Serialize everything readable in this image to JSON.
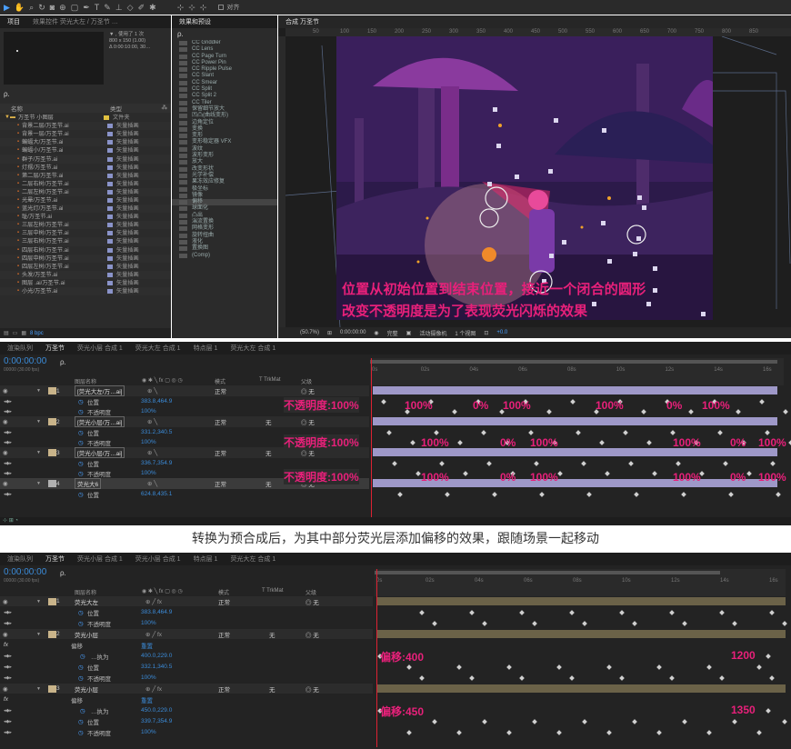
{
  "toolbar": {
    "label": "对齐"
  },
  "project": {
    "tab": "项目",
    "tab2": "效果控件 荧光大左 / 万圣节 …",
    "footage_info": [
      "▼ , 使用了 1 次",
      "800 x 150 (1.00)",
      "Δ 0:00:10:00, 30…"
    ],
    "search_placeholder": "ρ.",
    "col_name": "名称",
    "col_type": "类型",
    "items": [
      {
        "name": "万圣节 小图层",
        "type": "文件夹",
        "folder": true
      },
      {
        "name": "背景二层/万圣节.ai",
        "type": "矢量插画"
      },
      {
        "name": "背景一层/万圣节.ai",
        "type": "矢量插画"
      },
      {
        "name": "蝙蝠大/万圣节.ai",
        "type": "矢量插画"
      },
      {
        "name": "蝙蝠小/万圣节.ai",
        "type": "矢量插画"
      },
      {
        "name": "群子/万圣节.ai",
        "type": "矢量插画"
      },
      {
        "name": "灯摆/万圣节.ai",
        "type": "矢量插画"
      },
      {
        "name": "第二层/万圣节.ai",
        "type": "矢量插画"
      },
      {
        "name": "二层右树/万圣节.ai",
        "type": "矢量插画"
      },
      {
        "name": "二层左树/万圣节.ai",
        "type": "矢量插画"
      },
      {
        "name": "光晕/万圣节.ai",
        "type": "矢量插画"
      },
      {
        "name": "蓝光灯/万圣节.ai",
        "type": "矢量插画"
      },
      {
        "name": "耻/万圣节.ai",
        "type": "矢量插画"
      },
      {
        "name": "三层左树/万圣节.ai",
        "type": "矢量插画"
      },
      {
        "name": "三层中树/万圣节.ai",
        "type": "矢量插画"
      },
      {
        "name": "三层右树/万圣节.ai",
        "type": "矢量插画"
      },
      {
        "name": "四层右树/万圣节.ai",
        "type": "矢量插画"
      },
      {
        "name": "四层中树/万圣节.ai",
        "type": "矢量插画"
      },
      {
        "name": "四层左树/万圣节.ai",
        "type": "矢量插画"
      },
      {
        "name": "头发/万圣节.ai",
        "type": "矢量插画"
      },
      {
        "name": "图层 .ai/万圣节.ai",
        "type": "矢量插画"
      },
      {
        "name": "小光/万圣节.ai",
        "type": "矢量插画"
      }
    ],
    "bpc": "8 bpc"
  },
  "effects": {
    "tab": "效果和预设",
    "search": "ρ.",
    "items": [
      "CC Griddler",
      "CC Lens",
      "CC Page Turn",
      "CC Power Pin",
      "CC Ripple Pulse",
      "CC Slant",
      "CC Smear",
      "CC Split",
      "CC Split 2",
      "CC Tiler",
      "保留细节放大",
      "凹凸(曲线变形)",
      "边角定位",
      "变换",
      "变形",
      "变形稳定器 VFX",
      "波纹",
      "波形变形",
      "放大",
      "改变形状",
      "光学补偿",
      "果冻效应修复",
      "极坐标",
      "镜像",
      "偏移",
      "球面化",
      "凸出",
      "湍流置换",
      "网格变形",
      "旋转扭曲",
      "液化",
      "置换图",
      "(Comp)"
    ],
    "selected": "偏移"
  },
  "comp": {
    "tab": "合成",
    "tab_name": "万圣节",
    "rulers": [
      "50",
      "100",
      "150",
      "200",
      "250",
      "300",
      "350",
      "400",
      "450",
      "500",
      "550",
      "600",
      "650",
      "700",
      "750",
      "800",
      "850"
    ],
    "overlay_line1": "位置从初始位置到结束位置，接近一个闭合的圆形",
    "overlay_line2": "改变不透明度是为了表现荧光闪烁的效果",
    "footer": [
      "(50.7%)",
      "(完整)",
      "0:00:00:00",
      "完整",
      "活动摄像机",
      "1 个视图",
      "+0.0"
    ]
  },
  "tl1": {
    "tabs": [
      "渲染队列",
      "万圣节",
      "荧光小层 合成 1",
      "荧光大左 合成 1",
      "特点层 1",
      "荧光大左 合成 1"
    ],
    "time": "0:00:00:00",
    "time_sub": "00000 (30.00 fps)",
    "search": "ρ.",
    "head": {
      "name": "图层名称",
      "mode": "模式",
      "trk": "T TrkMat",
      "parent": "父级"
    },
    "layers": [
      {
        "num": "1",
        "name": "[荧光大左/万…ai]",
        "mode": "正常",
        "parent": "无",
        "pos": "383.8,464.9",
        "op": "100%"
      },
      {
        "num": "2",
        "name": "[荧光小层/万…ai]",
        "mode": "正常",
        "trk": "无",
        "parent": "无",
        "pos": "331.2,340.5",
        "op": "100%"
      },
      {
        "num": "3",
        "name": "[荧光小层/万…ai]",
        "mode": "正常",
        "trk": "无",
        "parent": "无",
        "pos": "336.7,354.9",
        "op": "100%"
      },
      {
        "num": "4",
        "name": "荧光大6",
        "mode": "正常",
        "trk": "无",
        "parent": "无",
        "pos": "624.8,435.1",
        "op": ""
      }
    ],
    "prop_pos": "位置",
    "prop_op": "不透明度",
    "ruler": [
      "0s",
      "02s",
      "04s",
      "06s",
      "08s",
      "10s",
      "12s",
      "14s",
      "16s"
    ],
    "ann": [
      {
        "label": "不透明度:100%",
        "vals": [
          "100%",
          "0%",
          "100%",
          "100%",
          "0%",
          "100%"
        ]
      },
      {
        "label": "不透明度:100%",
        "vals": [
          "100%",
          "0%",
          "100%",
          "100%",
          "0%",
          "100%"
        ]
      },
      {
        "label": "不透明度:100%",
        "vals": [
          "100%",
          "0%",
          "100%",
          "100%",
          "0%",
          "100%"
        ]
      }
    ]
  },
  "caption": "转换为预合成后，为其中部分荧光层添加偏移的效果，跟随场景一起移动",
  "tl2": {
    "tabs": [
      "渲染队列",
      "万圣节",
      "荧光小层 合成 1",
      "荧光小层 合成 1",
      "特点层 1",
      "荧光大左 合成 1"
    ],
    "time": "0:00:00:00",
    "time_sub": "00000 (30.00 fps)",
    "search": "ρ.",
    "head": {
      "name": "图层名称",
      "mode": "模式",
      "trk": "T TrkMat",
      "parent": "父级"
    },
    "rows": [
      {
        "kind": "layer",
        "num": "1",
        "name": "荧光大左",
        "mode": "正常",
        "parent": "无"
      },
      {
        "kind": "sub",
        "name": "位置",
        "val": "383.8,464.9"
      },
      {
        "kind": "sub",
        "name": "不透明度",
        "val": "100%"
      },
      {
        "kind": "layer",
        "num": "2",
        "name": "荧光小层",
        "mode": "正常",
        "trk": "无",
        "parent": "无"
      },
      {
        "kind": "fx",
        "name": "偏移",
        "val": "重置"
      },
      {
        "kind": "sub2",
        "name": "…执为",
        "val": "400.0,229.0"
      },
      {
        "kind": "sub",
        "name": "位置",
        "val": "332.1,340.5"
      },
      {
        "kind": "sub",
        "name": "不透明度",
        "val": "100%"
      },
      {
        "kind": "layer",
        "num": "3",
        "name": "荧光小层",
        "mode": "正常",
        "trk": "无",
        "parent": "无"
      },
      {
        "kind": "fx",
        "name": "偏移",
        "val": "重置"
      },
      {
        "kind": "sub2",
        "name": "…执为",
        "val": "450.0,229.0"
      },
      {
        "kind": "sub",
        "name": "位置",
        "val": "339.7,354.9"
      },
      {
        "kind": "sub",
        "name": "不透明度",
        "val": "100%"
      }
    ],
    "ruler": [
      "0s",
      "02s",
      "04s",
      "06s",
      "08s",
      "10s",
      "12s",
      "14s",
      "16s"
    ],
    "ann": [
      {
        "left": "偏移:400",
        "right": "1200"
      },
      {
        "left": "偏移:450",
        "right": "1350"
      }
    ]
  }
}
